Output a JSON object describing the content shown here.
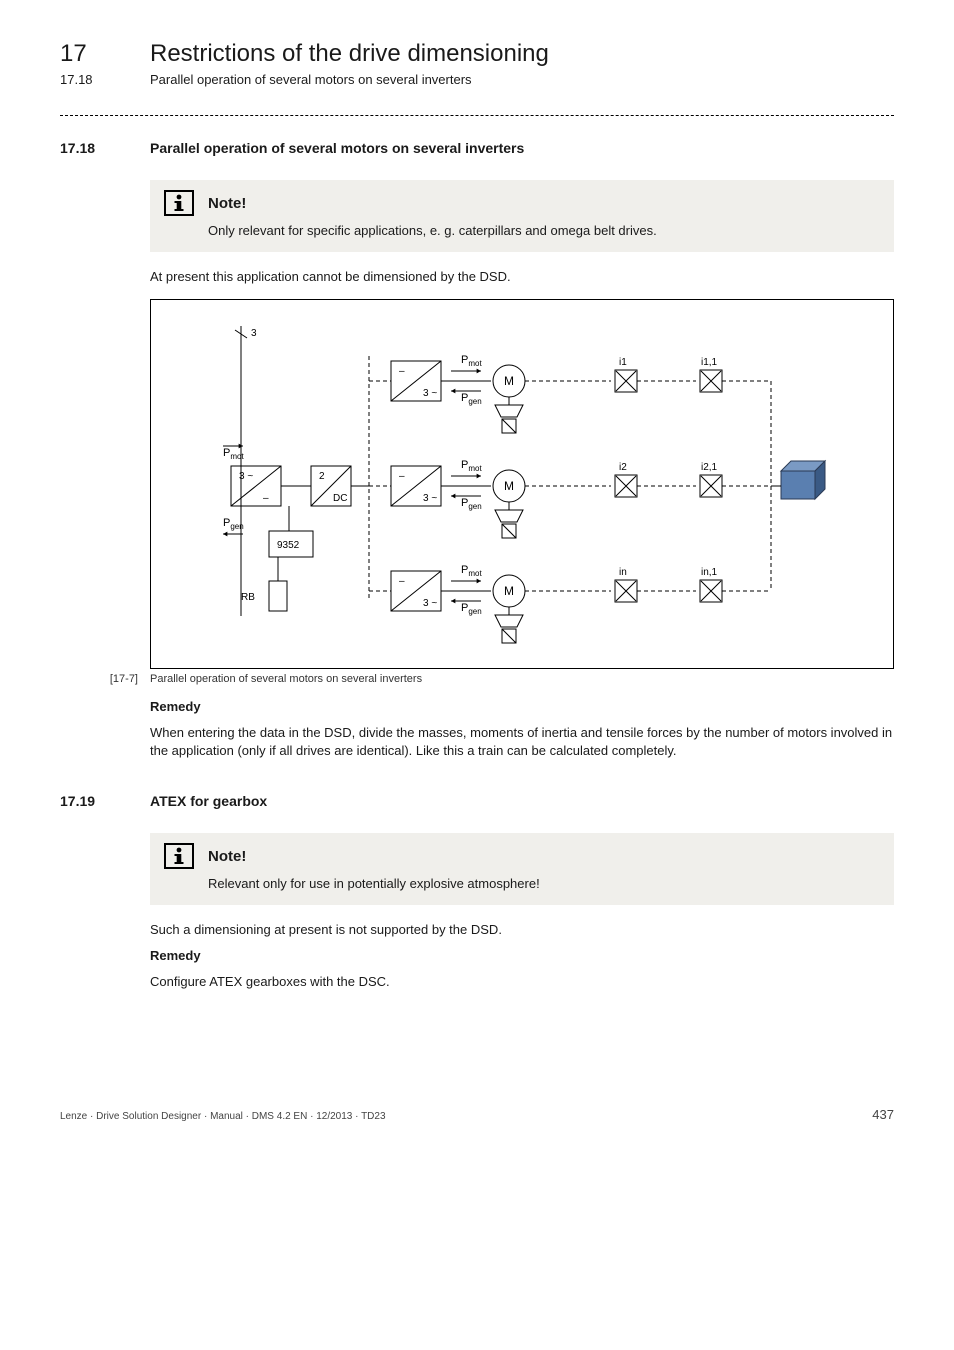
{
  "header": {
    "chapter_number": "17",
    "chapter_title": "Restrictions of the drive dimensioning",
    "sub_number": "17.18",
    "sub_title": "Parallel operation of several motors on several inverters"
  },
  "section_17_18": {
    "number": "17.18",
    "title": "Parallel operation of several motors on several inverters",
    "note_label": "Note!",
    "note_body": "Only relevant for specific applications, e. g. caterpillars and omega belt drives.",
    "para1": "At present this application cannot be dimensioned by the DSD.",
    "fig_tag": "[17-7]",
    "fig_caption": "Parallel operation of several motors on several inverters",
    "remedy_label": "Remedy",
    "remedy_body": "When entering the data in the DSD, divide the masses, moments of inertia and tensile forces by the number of motors involved in the application (only if all drives are identical). Like this a train can be calculated completely."
  },
  "section_17_19": {
    "number": "17.19",
    "title": "ATEX for gearbox",
    "note_label": "Note!",
    "note_body": "Relevant only for use in potentially explosive atmosphere!",
    "para1": "Such a dimensioning at present is not supported by the DSD.",
    "remedy_label": "Remedy",
    "remedy_body": "Configure ATEX gearboxes with the DSC."
  },
  "chart_data": {
    "type": "diagram",
    "description": "Block diagram: 3-phase supply → rectifier (3~/DC) → DC bus → three inverter branches. Each branch: inverter (3~) driving motor M via Pmot/Pgen arrows, motor connects to two gearbox stages (i1 → i1,1 etc.). Brake resistor RB on DC bus via module 9352.",
    "supply": "3",
    "rectifier": {
      "top": "3 ~",
      "bottom": "–",
      "labels": {
        "in": "Pmot",
        "out": "Pgen"
      }
    },
    "dc_link": {
      "top": "2",
      "bottom": "DC"
    },
    "brake": {
      "module": "9352",
      "resistor": "RB"
    },
    "branches": [
      {
        "inverter_top": "–",
        "inverter_bottom": "3 ~",
        "p_mot": "Pmot",
        "p_gen": "Pgen",
        "motor": "M",
        "gears": [
          "i 1",
          "i 1,1"
        ]
      },
      {
        "inverter_top": "–",
        "inverter_bottom": "3 ~",
        "p_mot": "Pmot",
        "p_gen": "Pgen",
        "motor": "M",
        "gears": [
          "i 2",
          "i 2,1"
        ]
      },
      {
        "inverter_top": "–",
        "inverter_bottom": "3 ~",
        "p_mot": "Pmot",
        "p_gen": "Pgen",
        "motor": "M",
        "gears": [
          "i n",
          "i n,1"
        ]
      }
    ],
    "load_box_color": "#5a7fb0"
  },
  "footer": {
    "text": "Lenze · Drive Solution Designer · Manual · DMS 4.2 EN · 12/2013 · TD23",
    "page": "437"
  }
}
